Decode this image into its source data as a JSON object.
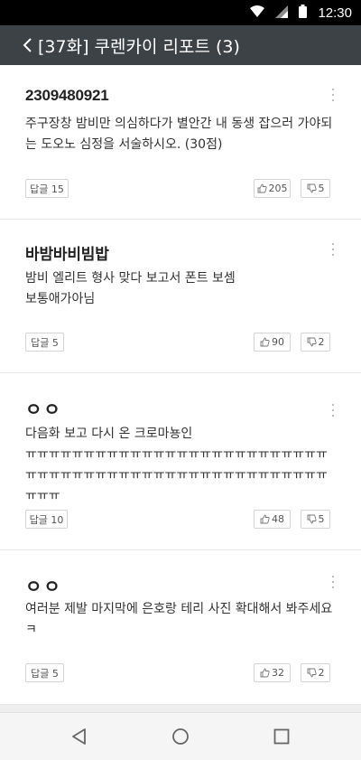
{
  "status_bar": {
    "time": "12:30",
    "icons": [
      "wifi-icon",
      "signal-icon",
      "battery-icon"
    ]
  },
  "header": {
    "title": "[37화] 쿠렌카이 리포트 (3)",
    "back_icon": "back-arrow-icon"
  },
  "comments": [
    {
      "author": "2309480921",
      "text": "주구장창 밤비만 의심하다가 별안간 내 동생 잡으러 가야되는 도오노 심정을 서술하시오. (30점)",
      "reply_label": "답글 15",
      "likes": "205",
      "dislikes": "5"
    },
    {
      "author": "바밤바비빔밥",
      "text": "밤비 엘리트 형사 맞다 보고서 폰트 보셈\n보통애가아님",
      "reply_label": "답글 5",
      "likes": "90",
      "dislikes": "2"
    },
    {
      "author": "ㅇㅇ",
      "text": "다음화 보고 다시 온 크로마뇽인\nㅠㅠㅠㅠㅠㅠㅠㅠㅠㅠㅠㅠㅠㅠㅠㅠㅠㅠㅠㅠㅠㅠㅠㅠㅠㅠㅠㅠㅠㅠㅠㅠㅠㅠㅠㅠㅠㅠㅠㅠㅠㅠㅠㅠㅠㅠㅠㅠㅠㅠㅠㅠㅠㅠㅠ",
      "reply_label": "답글 10",
      "likes": "48",
      "dislikes": "5"
    },
    {
      "author": "ㅇㅇ",
      "text": "여러분 제발 마지막에 은호랑 테리 사진 확대해서 봐주세요 ㅋ",
      "reply_label": "답글 5",
      "likes": "32",
      "dislikes": "2"
    }
  ],
  "nav_bar": {
    "icons": [
      "nav-back-icon",
      "nav-home-icon",
      "nav-recents-icon"
    ]
  },
  "colors": {
    "header_bg": "#3d4247",
    "status_bg": "#000000",
    "card_bg": "#ffffff",
    "divider": "#eeeeee"
  }
}
